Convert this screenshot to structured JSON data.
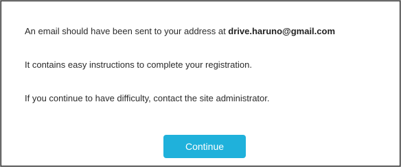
{
  "message": {
    "line1_prefix": "An email should have been sent to your address at ",
    "email": "drive.haruno@gmail.com",
    "line2": "It contains easy instructions to complete your registration.",
    "line3": "If you continue to have difficulty, contact the site administrator."
  },
  "actions": {
    "continue_label": "Continue"
  },
  "colors": {
    "button_bg": "#1fb1db",
    "button_text": "#ffffff",
    "text": "#2a2a2a",
    "border": "#8f8f8f"
  }
}
